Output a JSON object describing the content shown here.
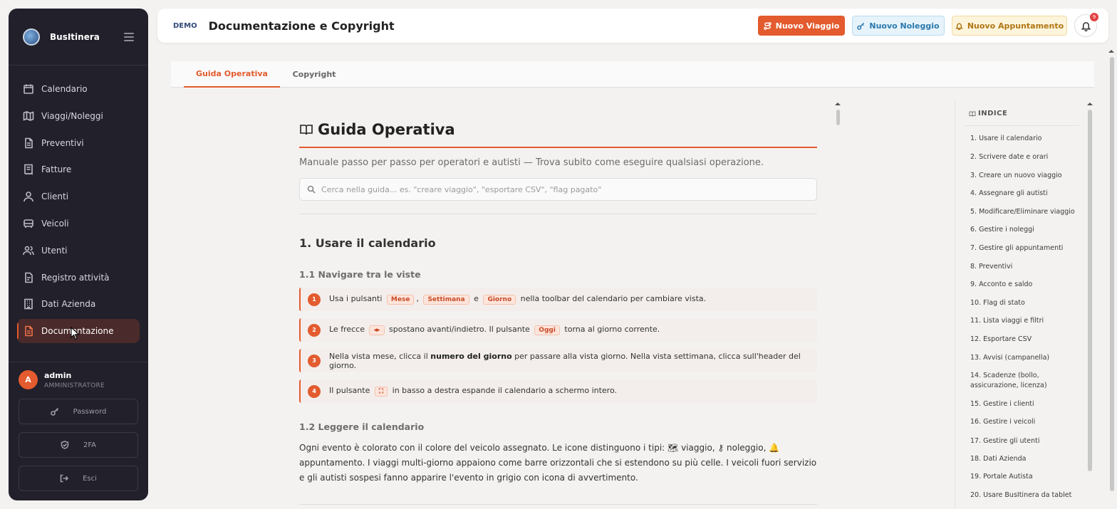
{
  "app": {
    "name": "BusItinera",
    "demo": "DEMO"
  },
  "header": {
    "title": "Documentazione e Copyright",
    "buttons": {
      "new_trip": "Nuovo Viaggio",
      "new_rental": "Nuovo Noleggio",
      "new_appointment": "Nuovo Appuntamento"
    },
    "notifications_count": "9"
  },
  "sidebar": {
    "items": [
      {
        "label": "Calendario",
        "icon": "calendar-icon"
      },
      {
        "label": "Viaggi/Noleggi",
        "icon": "map-icon"
      },
      {
        "label": "Preventivi",
        "icon": "document-icon"
      },
      {
        "label": "Fatture",
        "icon": "receipt-icon"
      },
      {
        "label": "Clienti",
        "icon": "user-icon"
      },
      {
        "label": "Veicoli",
        "icon": "bus-icon"
      },
      {
        "label": "Utenti",
        "icon": "users-icon"
      },
      {
        "label": "Registro attività",
        "icon": "log-icon"
      },
      {
        "label": "Dati Azienda",
        "icon": "building-icon"
      },
      {
        "label": "Documentazione",
        "icon": "docs-icon",
        "active": true
      }
    ],
    "user": {
      "initial": "A",
      "name": "admin",
      "role": "AMMINISTRATORE"
    },
    "buttons": {
      "password": "Password",
      "twofa": "2FA",
      "logout": "Esci"
    }
  },
  "tabs": [
    {
      "label": "Guida Operativa",
      "active": true
    },
    {
      "label": "Copyright"
    }
  ],
  "guide": {
    "title": "Guida Operativa",
    "subtitle": "Manuale passo per passo per operatori e autisti — Trova subito come eseguire qualsiasi operazione.",
    "search_placeholder": "Cerca nella guida... es. \"creare viaggio\", \"esportare CSV\", \"flag pagato\"",
    "section1_title": "1. Usare il calendario",
    "sub1_title": "1.1 Navigare tra le viste",
    "steps": {
      "s1": {
        "num": "1",
        "pre": "Usa i pulsanti",
        "k1": "Mese",
        "comma": ",",
        "k2": "Settimana",
        "and": "e",
        "k3": "Giorno",
        "post": "nella toolbar del calendario per cambiare vista."
      },
      "s2": {
        "num": "2",
        "pre": "Le frecce",
        "k1": "◂▸",
        "mid": "spostano avanti/indietro. Il pulsante",
        "k2": "Oggi",
        "post": "torna al giorno corrente."
      },
      "s3": {
        "num": "3",
        "pre": "Nella vista mese, clicca il",
        "bold": "numero del giorno",
        "post": "per passare alla vista giorno. Nella vista settimana, clicca sull'header del giorno."
      },
      "s4": {
        "num": "4",
        "pre": "Il pulsante",
        "k1": "⛶",
        "post": "in basso a destra espande il calendario a schermo intero."
      }
    },
    "sub2_title": "1.2 Leggere il calendario",
    "paragraph": "Ogni evento è colorato con il colore del veicolo assegnato. Le icone distinguono i tipi: 🗺 viaggio, ⚷ noleggio, 🔔 appuntamento. I viaggi multi-giorno appaiono come barre orizzontali che si estendono su più celle. I veicoli fuori servizio e gli autisti sospesi fanno apparire l'evento in grigio con icona di avvertimento."
  },
  "index": {
    "title": "INDICE",
    "items": [
      "1. Usare il calendario",
      "2. Scrivere date e orari",
      "3. Creare un nuovo viaggio",
      "4. Assegnare gli autisti",
      "5. Modificare/Eliminare viaggio",
      "6. Gestire i noleggi",
      "7. Gestire gli appuntamenti",
      "8. Preventivi",
      "9. Acconto e saldo",
      "10. Flag di stato",
      "11. Lista viaggi e filtri",
      "12. Esportare CSV",
      "13. Avvisi (campanella)",
      "14. Scadenze (bollo, assicurazione, licenza)",
      "15. Gestire i clienti",
      "16. Gestire i veicoli",
      "17. Gestire gli utenti",
      "18. Dati Azienda",
      "19. Portale Autista",
      "20. Usare BusItinera da tablet"
    ]
  },
  "colors": {
    "accent": "#e35b2e",
    "sidebar_bg": "#21202b"
  }
}
